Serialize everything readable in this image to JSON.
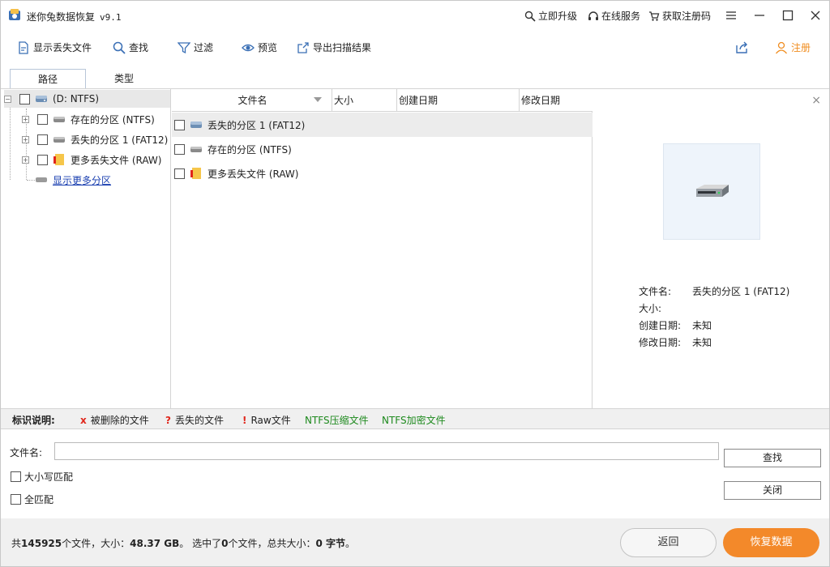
{
  "window": {
    "title": "迷你兔数据恢复",
    "version": "v9.1",
    "links": {
      "upgrade": "立即升级",
      "online_service": "在线服务",
      "get_code": "获取注册码"
    }
  },
  "toolbar": {
    "show_lost": "显示丢失文件",
    "find": "查找",
    "filter": "过滤",
    "preview": "预览",
    "export": "导出扫描结果",
    "register": "注册"
  },
  "tabs": {
    "path": "路径",
    "type": "类型"
  },
  "tree": {
    "root": "(D: NTFS)",
    "items": [
      {
        "label": "存在的分区 (NTFS)"
      },
      {
        "label": "丢失的分区 1 (FAT12)"
      },
      {
        "label": "更多丢失文件 (RAW)"
      }
    ],
    "more_link": "显示更多分区"
  },
  "filelist": {
    "columns": {
      "name": "文件名",
      "size": "大小",
      "created": "创建日期",
      "modified": "修改日期"
    },
    "rows": [
      {
        "name": "丢失的分区 1 (FAT12)"
      },
      {
        "name": "存在的分区 (NTFS)"
      },
      {
        "name": "更多丢失文件 (RAW)"
      }
    ]
  },
  "preview": {
    "close": "×",
    "labels": {
      "name": "文件名:",
      "size": "大小:",
      "created": "创建日期:",
      "modified": "修改日期:"
    },
    "values": {
      "name": "丢失的分区 1 (FAT12)",
      "size": "",
      "created": "未知",
      "modified": "未知"
    }
  },
  "legend": {
    "title": "标识说明:",
    "deleted": {
      "mark": "x",
      "text": "被删除的文件"
    },
    "lost": {
      "mark": "?",
      "text": "丢失的文件"
    },
    "raw": {
      "mark": "!",
      "text": "Raw文件"
    },
    "ntfs_compressed": "NTFS压缩文件",
    "ntfs_encrypted": "NTFS加密文件"
  },
  "search": {
    "label": "文件名:",
    "value": "",
    "match_case": "大小写匹配",
    "match_whole": "全匹配",
    "find_button": "查找",
    "close_button": "关闭"
  },
  "status": {
    "prefix": "共",
    "total_files": "145925",
    "files_unit": "个文件，大小：",
    "total_size": "48.37 GB",
    "selected_prefix": "。 选中了",
    "selected_count": "0",
    "selected_unit": "个文件，总共大小：",
    "selected_size": "0 字节",
    "suffix": "。"
  },
  "buttons": {
    "back": "返回",
    "recover": "恢复数据"
  },
  "colors": {
    "accent": "#f3892a",
    "link": "#1a3fb0",
    "legend_red": "#e0261b",
    "legend_green": "#1e8a1e"
  }
}
